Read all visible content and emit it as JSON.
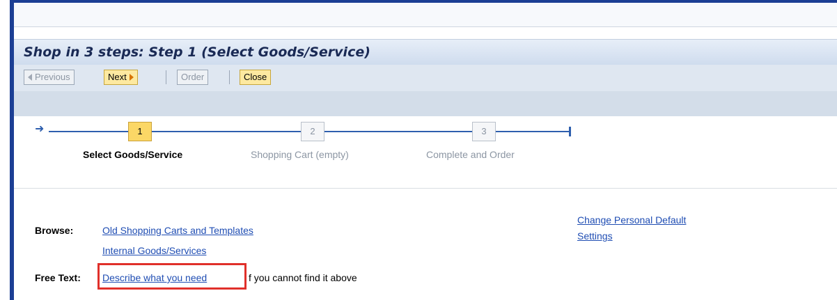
{
  "title": "Shop in 3 steps: Step 1  (Select Goods/Service)",
  "toolbar": {
    "previous_label": "Previous",
    "next_label": "Next",
    "order_label": "Order",
    "close_label": "Close"
  },
  "steps": [
    {
      "number": "1",
      "label": "Select Goods/Service",
      "state": "active"
    },
    {
      "number": "2",
      "label": "Shopping Cart (empty)",
      "state": "inactive"
    },
    {
      "number": "3",
      "label": "Complete and Order",
      "state": "inactive"
    }
  ],
  "browse": {
    "label": "Browse:",
    "links": [
      "Old Shopping Carts and Templates",
      "Internal Goods/Services"
    ]
  },
  "free_text": {
    "label": "Free Text:",
    "link": "Describe what you need",
    "suffix": "If you cannot find it above",
    "suffix_visible": "f you cannot find it above"
  },
  "settings_link": {
    "line1": "Change Personal Default",
    "line2": "Settings"
  },
  "colors": {
    "frame": "#1c3f94",
    "active_step": "#fbd766",
    "link": "#1f4db3",
    "highlight": "#e0302a"
  },
  "icons": {
    "previous": "triangle-left-icon",
    "next": "triangle-right-icon",
    "start": "start-arrow-icon",
    "end": "end-cap-icon"
  }
}
